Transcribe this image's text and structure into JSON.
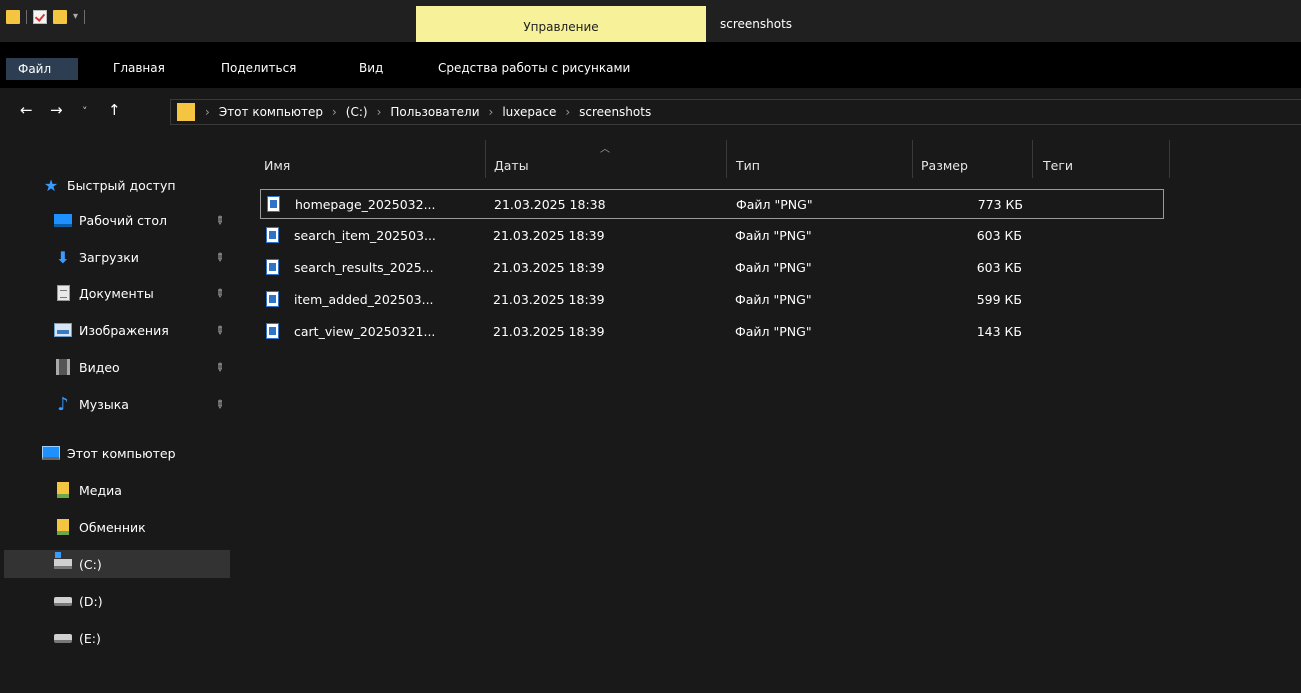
{
  "window": {
    "contextual_tab": "Управление",
    "title": "screenshots"
  },
  "ribbon": {
    "tabs": [
      "Файл",
      "Главная",
      "Поделиться",
      "Вид",
      "Средства работы с рисунками"
    ]
  },
  "address": {
    "crumbs": [
      "Этот компьютер",
      "(C:)",
      "Пользователи",
      "luxepace",
      "screenshots"
    ]
  },
  "sidebar": {
    "quick_access": "Быстрый доступ",
    "items": [
      {
        "label": "Рабочий стол",
        "icon": "desktop-icon",
        "pinned": true
      },
      {
        "label": "Загрузки",
        "icon": "downloads-icon",
        "pinned": true
      },
      {
        "label": "Документы",
        "icon": "documents-icon",
        "pinned": true
      },
      {
        "label": "Изображения",
        "icon": "pictures-icon",
        "pinned": true
      },
      {
        "label": "Видео",
        "icon": "video-icon",
        "pinned": true
      },
      {
        "label": "Музыка",
        "icon": "music-icon",
        "pinned": true
      }
    ],
    "this_pc": "Этот компьютер",
    "locations": [
      {
        "label": "Медиа",
        "icon": "network-share-icon"
      },
      {
        "label": "Обменник",
        "icon": "network-share-icon"
      },
      {
        "label": "(C:)",
        "icon": "windows-drive-icon",
        "selected": true
      },
      {
        "label": "(D:)",
        "icon": "drive-icon"
      },
      {
        "label": "(E:)",
        "icon": "drive-icon"
      }
    ]
  },
  "columns": {
    "name": "Имя",
    "date": "Даты",
    "type": "Тип",
    "size": "Размер",
    "tags": "Теги"
  },
  "files": [
    {
      "name": "homepage_2025032...",
      "date": "21.03.2025 18:38",
      "type": "Файл \"PNG\"",
      "size": "773 КБ"
    },
    {
      "name": "search_item_202503...",
      "date": "21.03.2025 18:39",
      "type": "Файл \"PNG\"",
      "size": "603 КБ"
    },
    {
      "name": "search_results_2025...",
      "date": "21.03.2025 18:39",
      "type": "Файл \"PNG\"",
      "size": "603 КБ"
    },
    {
      "name": "item_added_202503...",
      "date": "21.03.2025 18:39",
      "type": "Файл \"PNG\"",
      "size": "599 КБ"
    },
    {
      "name": "cart_view_20250321...",
      "date": "21.03.2025 18:39",
      "type": "Файл \"PNG\"",
      "size": "143 КБ"
    }
  ],
  "colors": {
    "accent": "#f7f29a",
    "background": "#191919",
    "selection": "#333333"
  }
}
